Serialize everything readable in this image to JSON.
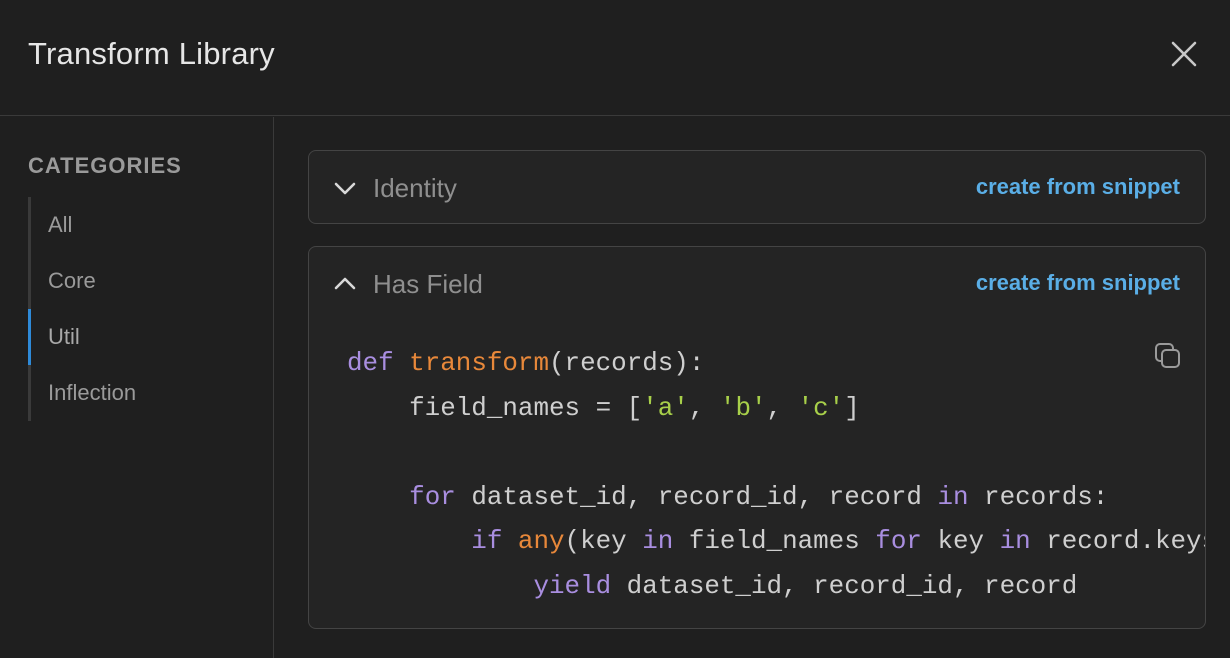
{
  "header": {
    "title": "Transform Library",
    "close_icon": "close-icon"
  },
  "sidebar": {
    "title": "CATEGORIES",
    "items": [
      {
        "label": "All"
      },
      {
        "label": "Core"
      },
      {
        "label": "Util",
        "active": true
      },
      {
        "label": "Inflection"
      }
    ]
  },
  "panels": [
    {
      "name": "Identity",
      "action": "create from snippet",
      "expanded": false
    },
    {
      "name": "Has Field",
      "action": "create from snippet",
      "expanded": true,
      "code": {
        "lines": [
          [
            {
              "t": "kw",
              "v": "def"
            },
            {
              "t": "p",
              "v": " "
            },
            {
              "t": "fn",
              "v": "transform"
            },
            {
              "t": "p",
              "v": "(records):"
            }
          ],
          [
            {
              "t": "p",
              "v": "    field_names = ["
            },
            {
              "t": "str",
              "v": "'a'"
            },
            {
              "t": "p",
              "v": ", "
            },
            {
              "t": "str",
              "v": "'b'"
            },
            {
              "t": "p",
              "v": ", "
            },
            {
              "t": "str",
              "v": "'c'"
            },
            {
              "t": "p",
              "v": "]"
            }
          ],
          [],
          [
            {
              "t": "p",
              "v": "    "
            },
            {
              "t": "kw",
              "v": "for"
            },
            {
              "t": "p",
              "v": " dataset_id, record_id, record "
            },
            {
              "t": "kw",
              "v": "in"
            },
            {
              "t": "p",
              "v": " records:"
            }
          ],
          [
            {
              "t": "p",
              "v": "        "
            },
            {
              "t": "kw",
              "v": "if"
            },
            {
              "t": "p",
              "v": " "
            },
            {
              "t": "fn",
              "v": "any"
            },
            {
              "t": "p",
              "v": "(key "
            },
            {
              "t": "kw",
              "v": "in"
            },
            {
              "t": "p",
              "v": " field_names "
            },
            {
              "t": "kw",
              "v": "for"
            },
            {
              "t": "p",
              "v": " key "
            },
            {
              "t": "kw",
              "v": "in"
            },
            {
              "t": "p",
              "v": " record.keys()):"
            }
          ],
          [
            {
              "t": "p",
              "v": "            "
            },
            {
              "t": "kw",
              "v": "yield"
            },
            {
              "t": "p",
              "v": " dataset_id, record_id, record"
            }
          ]
        ]
      },
      "copy_icon": "copy-icon"
    }
  ],
  "colors": {
    "background": "#1f1f1f",
    "accent": "#2e8ad8",
    "link": "#5aaee6",
    "keyword": "#a98ee0",
    "function": "#e8883a",
    "string": "#a8d04a"
  }
}
